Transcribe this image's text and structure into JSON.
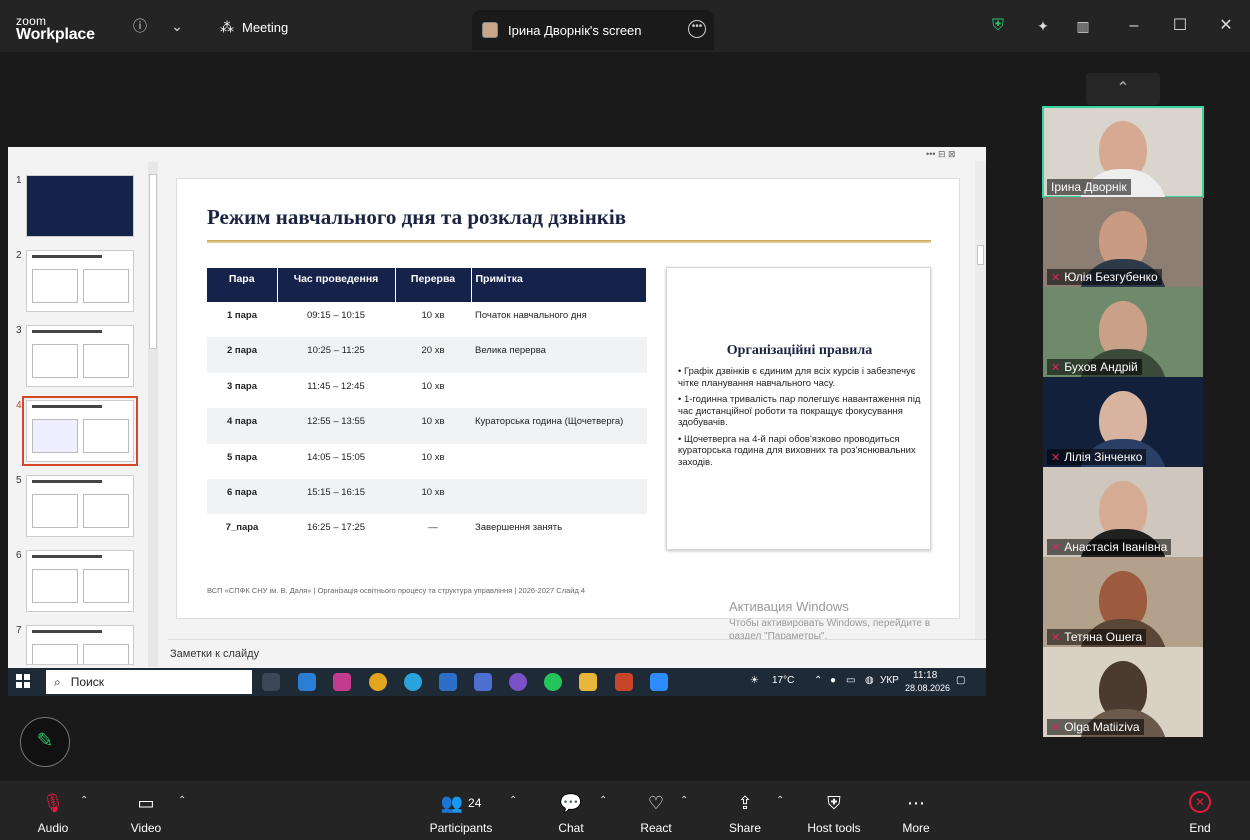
{
  "titlebar": {
    "logo_line1": "zoom",
    "logo_line2": "Workplace",
    "meeting_label": "Meeting",
    "screen_tab_label": "Ірина Дворнік's screen"
  },
  "slide": {
    "title": "Режим навчального дня та розклад дзвінків",
    "table_headers": [
      "Пара",
      "Час проведення",
      "Перерва",
      "Примітка"
    ],
    "rows": [
      {
        "para": "1 пара",
        "time": "09:15 – 10:15",
        "break": "10 хв",
        "note": "Початок навчального дня"
      },
      {
        "para": "2 пара",
        "time": "10:25 – 11:25",
        "break": "20 хв",
        "note": "Велика перерва"
      },
      {
        "para": "3 пара",
        "time": "11:45 – 12:45",
        "break": "10 хв",
        "note": ""
      },
      {
        "para": "4 пара",
        "time": "12:55 – 13:55",
        "break": "10 хв",
        "note": "Кураторська година (Щочетверга)"
      },
      {
        "para": "5 пара",
        "time": "14:05 – 15:05",
        "break": "10 хв",
        "note": ""
      },
      {
        "para": "6 пара",
        "time": "15:15 – 16:15",
        "break": "10 хв",
        "note": ""
      },
      {
        "para": "7_пара",
        "time": "16:25 – 17:25",
        "break": "—",
        "note": "Завершення занять"
      }
    ],
    "rules_title": "Організаційні правила",
    "rules": [
      "• Графік дзвінків є єдиним для всіх курсів і забезпечує чітке планування навчального часу.",
      "• 1-годинна тривалість пар полегшує навантаження під час дистанційної роботи та покращує фокусування здобувачів.",
      "• Щочетверга на 4-й парі обов'язково проводиться кураторська година для виховних та роз'яснювальних заходів."
    ],
    "footer": "ВСП «СПФК СНУ ім. В. Даля»  |  Організація освітнього процесу та структура управління  |  2026-2027     Слайд 4"
  },
  "thumbnails": [
    "1",
    "2",
    "3",
    "4",
    "5",
    "6",
    "7"
  ],
  "notes_label": "Заметки к слайду",
  "activation": {
    "line1": "Активация Windows",
    "line2": "Чтобы активировать Windows, перейдите в раздел \"Параметры\"."
  },
  "taskbar": {
    "search_label": "Поиск",
    "weather": "17°C",
    "lang": "УКР",
    "time": "11:18",
    "date": "28.08.2026"
  },
  "participants": [
    {
      "name": "Ірина Дворнік",
      "muted": false
    },
    {
      "name": "Юлія Безгубенко",
      "muted": true
    },
    {
      "name": "Бухов Андрій",
      "muted": true
    },
    {
      "name": "Лілія Зінченко",
      "muted": true
    },
    {
      "name": "Анастасія Іванівна",
      "muted": true
    },
    {
      "name": "Тетяна Ошега",
      "muted": true
    },
    {
      "name": "Olga Matiiziva",
      "muted": true
    }
  ],
  "toolbar": {
    "audio": "Audio",
    "video": "Video",
    "participants": "Participants",
    "participants_count": "24",
    "chat": "Chat",
    "react": "React",
    "share": "Share",
    "host_tools": "Host tools",
    "more": "More",
    "end": "End"
  },
  "colors": {
    "active_speaker": "#35d6a0",
    "end_red": "#e8173d",
    "slide_navy": "#15234a",
    "ppt_orange": "#d24726"
  }
}
